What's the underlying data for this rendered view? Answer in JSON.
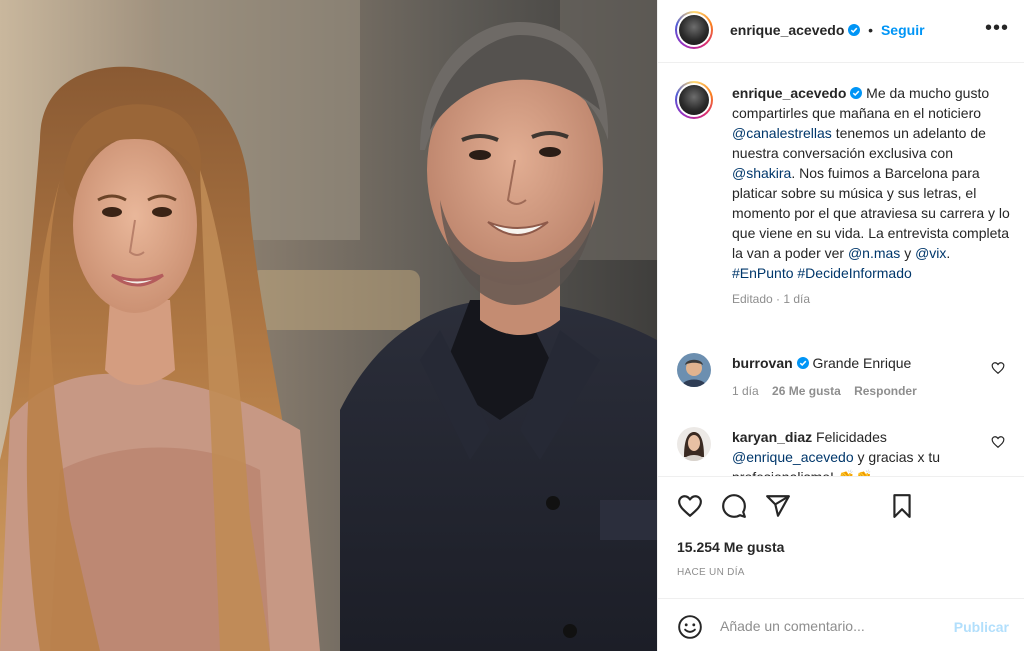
{
  "post": {
    "author": "enrique_acevedo",
    "follow_label": "Seguir",
    "dot": "•",
    "more": "•••"
  },
  "caption": {
    "username": "enrique_acevedo",
    "text_1": " Me da mucho gusto compartirles que mañana en el noticiero ",
    "mention_1": "@canalestrellas",
    "text_2": " tenemos un adelanto de nuestra conversación exclusiva con ",
    "mention_2": "@shakira",
    "text_3": ". Nos fuimos a Barcelona para platicar sobre su música y sus letras, el momento por el que atraviesa su carrera y lo que viene en su vida. La entrevista completa la van a poder ver ",
    "mention_3": "@n.mas",
    "text_4": " y ",
    "mention_4": "@vix",
    "text_5": ".",
    "hashtag_1": "#EnPunto",
    "hashtag_2": "#DecideInformado",
    "edited": "Editado",
    "sep": " · ",
    "time": "1 día"
  },
  "comments": [
    {
      "username": "burrovan",
      "text": " Grande Enrique",
      "time": "1 día",
      "likes": "26 Me gusta",
      "reply": "Responder"
    },
    {
      "username": "karyan_diaz",
      "text_1": " Felicidades ",
      "mention": "@enrique_acevedo",
      "text_2": " y gracias x tu profesionalismo! 👏👏"
    }
  ],
  "actions": {
    "likes": "15.254 Me gusta",
    "time": "HACE UN DÍA"
  },
  "add_comment": {
    "placeholder": "Añade un comentario...",
    "publish": "Publicar"
  },
  "colors": {
    "accent": "#0095f6",
    "link": "#00376b",
    "muted": "#8e8e8e"
  }
}
